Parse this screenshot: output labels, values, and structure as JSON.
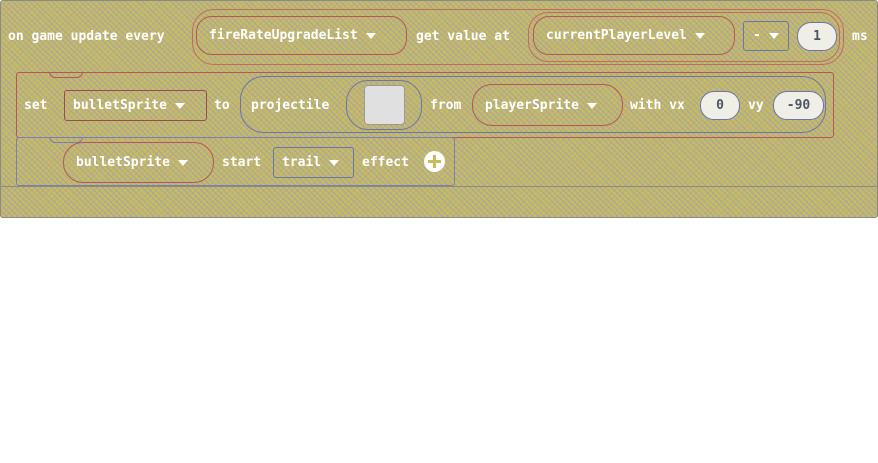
{
  "event_block": {
    "prefix": "on game update every",
    "list_variable": "fireRateUpgradeList",
    "get_value_label": "get value at",
    "index_variable": "currentPlayerLevel",
    "operator": "-",
    "operand": "1",
    "unit": "ms"
  },
  "set_block": {
    "set_label": "set",
    "variable": "bulletSprite",
    "to_label": "to",
    "projectile_label": "projectile",
    "from_label": "from",
    "source_sprite": "playerSprite",
    "vx_label": "with vx",
    "vx_value": "0",
    "vy_label": "vy",
    "vy_value": "-90"
  },
  "effect_block": {
    "sprite": "bulletSprite",
    "start_label": "start",
    "effect_name": "trail",
    "effect_label": "effect"
  },
  "icons": {
    "dropdown": "caret-down-icon",
    "add": "plus-circle-icon"
  },
  "colors": {
    "block_fill": "#c3bf5c",
    "number_field": "#efefe8",
    "text": "#ffffff"
  }
}
